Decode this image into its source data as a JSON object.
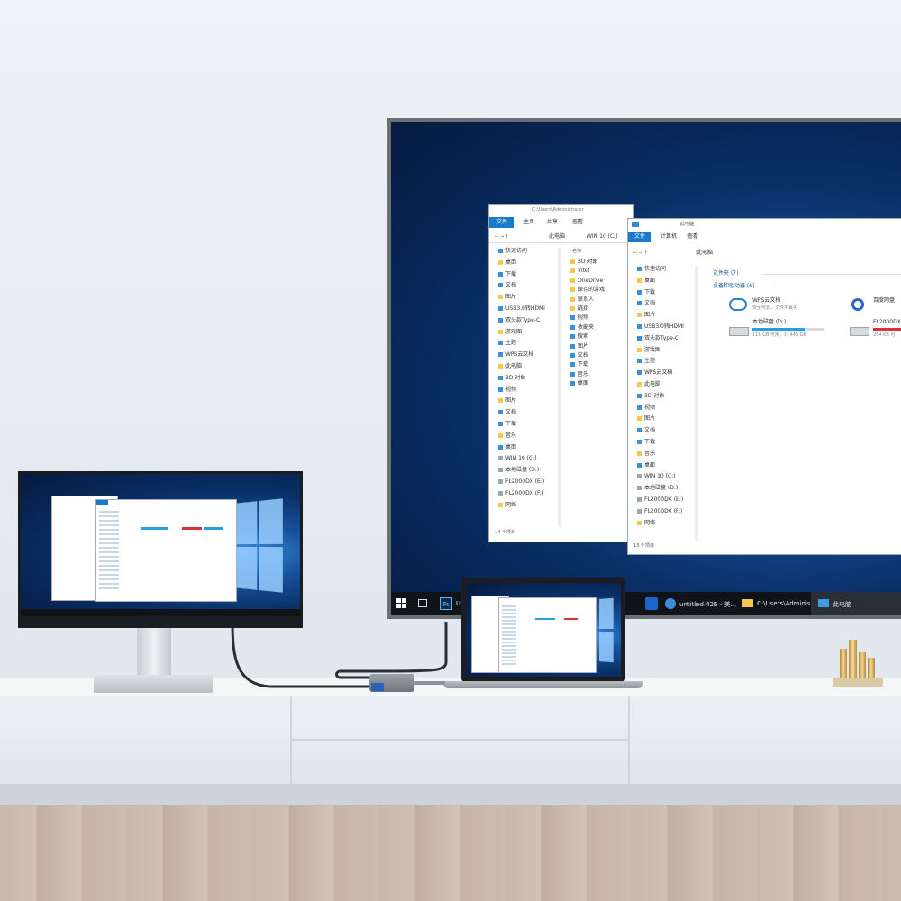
{
  "scene": "multi-display setup",
  "tv": {
    "explorer_back": {
      "title_path": "C:\\Users\\Administrator",
      "tabs": [
        "文件",
        "主页",
        "共享",
        "查看"
      ],
      "address": [
        "此电脑",
        "WIN 10 (C:)"
      ],
      "nav": [
        "快速访问",
        "桌面",
        "下载",
        "文档",
        "图片",
        "USB3.0转HDMI",
        "双头款Type-C",
        "游戏图",
        "主题",
        "WPS云文档",
        "此电脑",
        "3D 对象",
        "视频",
        "图片",
        "文档",
        "下载",
        "音乐",
        "桌面",
        "WIN 10 (C:)",
        "本地磁盘 (D:)",
        "FL2000DX (E:)",
        "FL2000DX (F:)",
        "网络"
      ],
      "column_header": "名称",
      "files": [
        "3D 对象",
        "Intel",
        "OneDrive",
        "保存的游戏",
        "联系人",
        "链接",
        "视频",
        "收藏夹",
        "搜索",
        "图片",
        "文档",
        "下载",
        "音乐",
        "桌面"
      ],
      "status": "14 个项目"
    },
    "explorer_front": {
      "title": "此电脑",
      "tabs": [
        "文件",
        "计算机",
        "查看"
      ],
      "address": "此电脑",
      "nav": [
        "快速访问",
        "桌面",
        "下载",
        "文档",
        "图片",
        "USB3.0转HDMI",
        "双头款Type-C",
        "游戏图",
        "主题",
        "WPS云文档",
        "此电脑",
        "3D 对象",
        "视频",
        "图片",
        "文档",
        "下载",
        "音乐",
        "桌面",
        "WIN 10 (C:)",
        "本地磁盘 (D:)",
        "FL2000DX (E:)",
        "FL2000DX (F:)",
        "网络"
      ],
      "group_folders": "文件夹 (7)",
      "group_devices": "设备和驱动器 (6)",
      "devices": [
        {
          "name": "WPS云文档",
          "sub": "安全可靠，文件不丢失",
          "icon": "cloud-icon"
        },
        {
          "name": "百度网盘",
          "sub": "",
          "icon": "baidu-icon"
        }
      ],
      "drives": [
        {
          "name": "本地磁盘 (D:)",
          "detail": "116 GB 可用，共 445 GB",
          "used": 0.74,
          "color": "#26a0da"
        },
        {
          "name": "FL2000DX",
          "detail": "264 KB 可",
          "used": 0.92,
          "color": "#d9303a"
        }
      ],
      "status": "13 个项目"
    },
    "taskbar": {
      "items": [
        {
          "label": "",
          "icon": "windows-start-icon"
        },
        {
          "label": "",
          "icon": "task-view-icon"
        },
        {
          "label": "Ps",
          "icon": "photoshop-icon"
        },
        {
          "label": "US",
          "icon": "usb-app-icon"
        },
        {
          "label": "untitled.426 - 美...",
          "icon": "meitu-icon"
        },
        {
          "label": "C:\\Users\\Adminis...",
          "icon": "folder-icon"
        },
        {
          "label": "此电脑",
          "icon": "this-pc-icon"
        }
      ]
    }
  },
  "colors": {
    "accent": "#1979ca",
    "drive_blue": "#26a0da",
    "drive_red": "#d9303a",
    "taskbar": "#101318"
  }
}
